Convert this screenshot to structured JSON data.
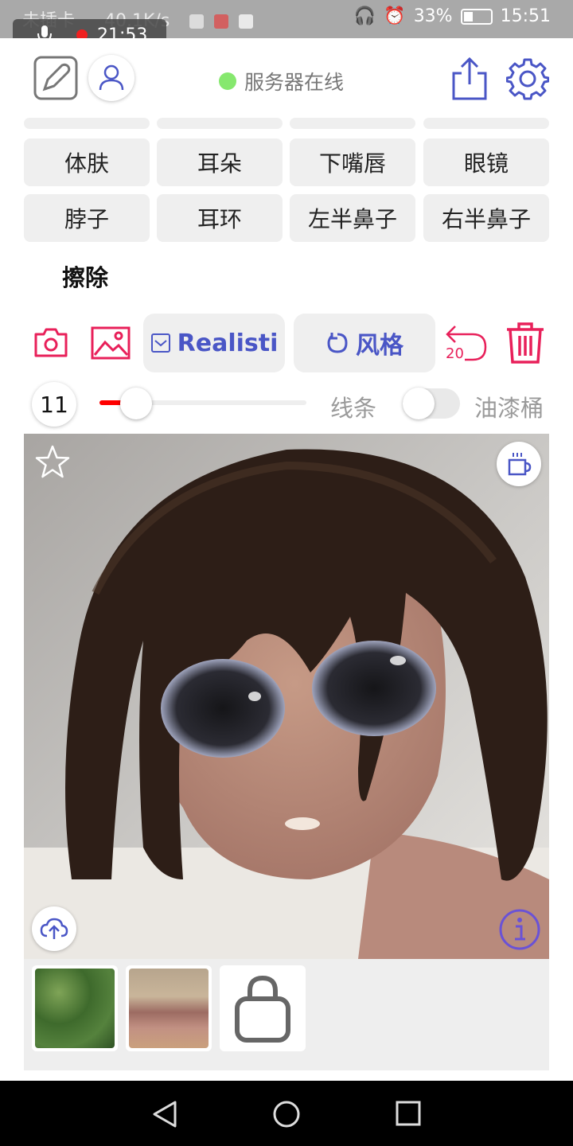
{
  "status_bar": {
    "carrier": "未插卡",
    "network_speed": "40.1K/s",
    "battery": "33%",
    "time": "15:51",
    "recording_time": "21:53"
  },
  "header": {
    "server_status": "服务器在线",
    "status_color": "#86e86e",
    "accent": "#4a56c6"
  },
  "parts": {
    "row1": [
      "体肤",
      "耳朵",
      "下嘴唇",
      "眼镜"
    ],
    "row2": [
      "脖子",
      "耳环",
      "左半鼻子",
      "右半鼻子"
    ],
    "erase": "擦除"
  },
  "toolbar": {
    "style_select": "Realisti",
    "style_button": "风格",
    "undo_count": "20",
    "icons": [
      "camera-icon",
      "image-icon",
      "undo-icon",
      "trash-icon"
    ],
    "icon_color": "#e8205a"
  },
  "brush": {
    "size": "11",
    "slider_fraction": 0.18,
    "lines_label": "线条",
    "bucket_label": "油漆桶",
    "bucket_enabled": false
  },
  "canvas": {
    "icons": [
      "star-icon",
      "coffee-icon",
      "upload-icon",
      "info-icon"
    ]
  },
  "thumbnails": [
    "thumbnail-grass",
    "thumbnail-texture",
    "shop-bag-icon"
  ]
}
